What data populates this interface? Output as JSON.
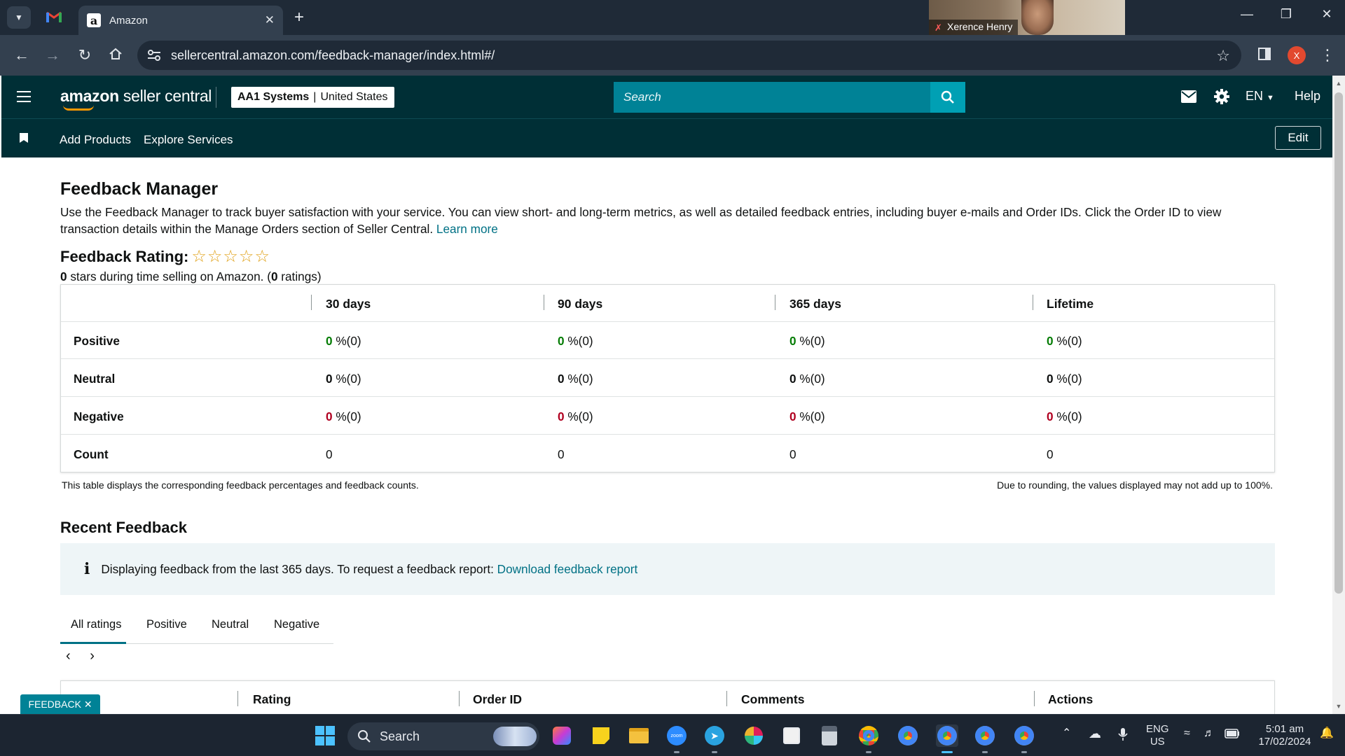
{
  "browser": {
    "tab_title": "Amazon",
    "url": "sellercentral.amazon.com/feedback-manager/index.html#/",
    "profile_initial": "X",
    "video_name": "Xerence Henry"
  },
  "header": {
    "logo_bold": "amazon",
    "logo_rest": " seller central",
    "account_name": "AA1 Systems",
    "account_region": "United States",
    "search_placeholder": "Search",
    "language": "EN",
    "help": "Help"
  },
  "subnav": {
    "items": [
      "Add Products",
      "Explore Services"
    ],
    "edit_label": "Edit"
  },
  "page": {
    "title": "Feedback Manager",
    "intro": "Use the Feedback Manager to track buyer satisfaction with your service. You can view short- and long-term metrics, as well as detailed feedback entries, including buyer e-mails and Order IDs. Click the Order ID to view transaction details within the Manage Orders section of Seller Central.",
    "learn_more": "Learn more",
    "rating_label": "Feedback Rating:",
    "rating_stars": 0,
    "rating_sub_value": "0",
    "rating_sub_mid": " stars during time selling on Amazon. (",
    "rating_sub_count": "0",
    "rating_sub_end": " ratings)"
  },
  "feedback_table": {
    "columns": [
      "30 days",
      "90 days",
      "365 days",
      "Lifetime"
    ],
    "rows": [
      {
        "label": "Positive",
        "cells": [
          {
            "num": "0",
            "rest": " %(0)"
          },
          {
            "num": "0",
            "rest": " %(0)"
          },
          {
            "num": "0",
            "rest": " %(0)"
          },
          {
            "num": "0",
            "rest": " %(0)"
          }
        ]
      },
      {
        "label": "Neutral",
        "cells": [
          {
            "num": "0",
            "rest": " %(0)"
          },
          {
            "num": "0",
            "rest": " %(0)"
          },
          {
            "num": "0",
            "rest": " %(0)"
          },
          {
            "num": "0",
            "rest": " %(0)"
          }
        ]
      },
      {
        "label": "Negative",
        "cells": [
          {
            "num": "0",
            "rest": " %(0)"
          },
          {
            "num": "0",
            "rest": " %(0)"
          },
          {
            "num": "0",
            "rest": " %(0)"
          },
          {
            "num": "0",
            "rest": " %(0)"
          }
        ]
      },
      {
        "label": "Count",
        "cells": [
          {
            "num": "0",
            "rest": ""
          },
          {
            "num": "0",
            "rest": ""
          },
          {
            "num": "0",
            "rest": ""
          },
          {
            "num": "0",
            "rest": ""
          }
        ]
      }
    ],
    "note_left": "This table displays the corresponding feedback percentages and feedback counts.",
    "note_right": "Due to rounding, the values displayed may not add up to 100%."
  },
  "recent": {
    "title": "Recent Feedback",
    "info_text": "Displaying feedback from the last 365 days. To request a feedback report:",
    "info_link": "Download feedback report",
    "tabs": [
      "All ratings",
      "Positive",
      "Neutral",
      "Negative"
    ],
    "columns": [
      "Rating",
      "Order ID",
      "Comments",
      "Actions"
    ]
  },
  "feedback_tab": "FEEDBACK",
  "taskbar": {
    "search": "Search",
    "lang_top": "ENG",
    "lang_bottom": "US",
    "time": "5:01 am",
    "date": "17/02/2024"
  },
  "colors": {
    "header_bg": "#002f36",
    "search_bg": "#008296",
    "link": "#007185",
    "positive": "#067d06",
    "negative": "#b00020",
    "star": "#e0a21a"
  }
}
